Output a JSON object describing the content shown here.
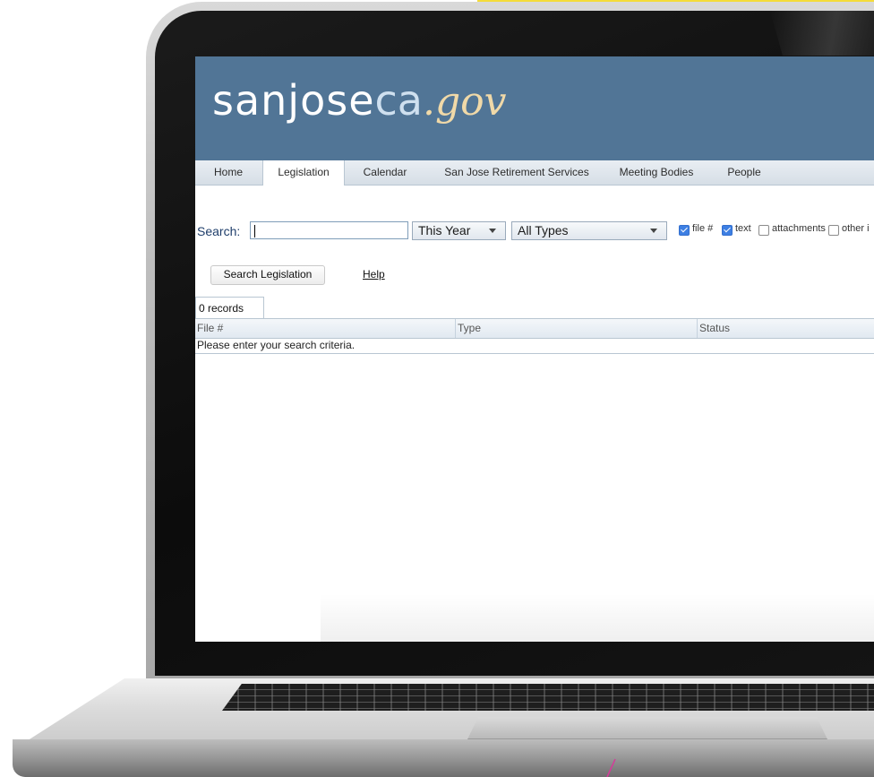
{
  "site": {
    "logo_main": "sanjose",
    "logo_ca": "ca",
    "logo_gov": ".gov"
  },
  "nav": {
    "tabs": [
      {
        "label": "Home",
        "active": false
      },
      {
        "label": "Legislation",
        "active": true
      },
      {
        "label": "Calendar",
        "active": false
      },
      {
        "label": "San Jose Retirement Services",
        "active": false
      },
      {
        "label": "Meeting Bodies",
        "active": false
      },
      {
        "label": "People",
        "active": false
      }
    ]
  },
  "search": {
    "label": "Search:",
    "value": "",
    "year_select": "This Year",
    "type_select": "All Types",
    "options": [
      {
        "label": "file #",
        "checked": true
      },
      {
        "label": "text",
        "checked": true
      },
      {
        "label": "attachments",
        "checked": false
      },
      {
        "label": "other i",
        "checked": false
      }
    ],
    "search_button": "Search Legislation",
    "help_link": "Help"
  },
  "results": {
    "records_tab": "0 records",
    "columns": [
      "File #",
      "Type",
      "Status"
    ],
    "empty_message": "Please enter your search criteria."
  },
  "colors": {
    "banner": "#517596",
    "checkbox_checked": "#3d7fe3",
    "accent_yellow": "#f4dc3a"
  }
}
